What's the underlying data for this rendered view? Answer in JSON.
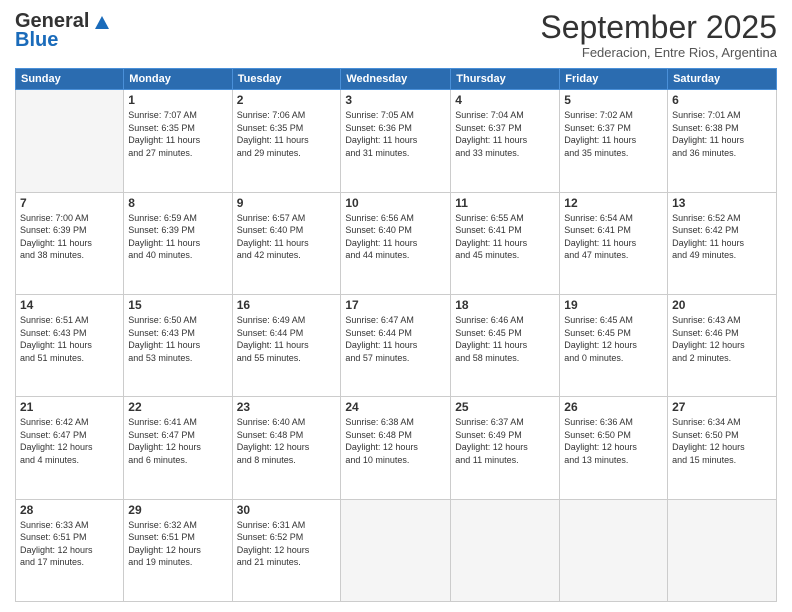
{
  "header": {
    "logo_general": "General",
    "logo_blue": "Blue",
    "month": "September 2025",
    "location": "Federacion, Entre Rios, Argentina"
  },
  "weekdays": [
    "Sunday",
    "Monday",
    "Tuesday",
    "Wednesday",
    "Thursday",
    "Friday",
    "Saturday"
  ],
  "weeks": [
    [
      {
        "day": "",
        "info": ""
      },
      {
        "day": "1",
        "info": "Sunrise: 7:07 AM\nSunset: 6:35 PM\nDaylight: 11 hours\nand 27 minutes."
      },
      {
        "day": "2",
        "info": "Sunrise: 7:06 AM\nSunset: 6:35 PM\nDaylight: 11 hours\nand 29 minutes."
      },
      {
        "day": "3",
        "info": "Sunrise: 7:05 AM\nSunset: 6:36 PM\nDaylight: 11 hours\nand 31 minutes."
      },
      {
        "day": "4",
        "info": "Sunrise: 7:04 AM\nSunset: 6:37 PM\nDaylight: 11 hours\nand 33 minutes."
      },
      {
        "day": "5",
        "info": "Sunrise: 7:02 AM\nSunset: 6:37 PM\nDaylight: 11 hours\nand 35 minutes."
      },
      {
        "day": "6",
        "info": "Sunrise: 7:01 AM\nSunset: 6:38 PM\nDaylight: 11 hours\nand 36 minutes."
      }
    ],
    [
      {
        "day": "7",
        "info": "Sunrise: 7:00 AM\nSunset: 6:39 PM\nDaylight: 11 hours\nand 38 minutes."
      },
      {
        "day": "8",
        "info": "Sunrise: 6:59 AM\nSunset: 6:39 PM\nDaylight: 11 hours\nand 40 minutes."
      },
      {
        "day": "9",
        "info": "Sunrise: 6:57 AM\nSunset: 6:40 PM\nDaylight: 11 hours\nand 42 minutes."
      },
      {
        "day": "10",
        "info": "Sunrise: 6:56 AM\nSunset: 6:40 PM\nDaylight: 11 hours\nand 44 minutes."
      },
      {
        "day": "11",
        "info": "Sunrise: 6:55 AM\nSunset: 6:41 PM\nDaylight: 11 hours\nand 45 minutes."
      },
      {
        "day": "12",
        "info": "Sunrise: 6:54 AM\nSunset: 6:41 PM\nDaylight: 11 hours\nand 47 minutes."
      },
      {
        "day": "13",
        "info": "Sunrise: 6:52 AM\nSunset: 6:42 PM\nDaylight: 11 hours\nand 49 minutes."
      }
    ],
    [
      {
        "day": "14",
        "info": "Sunrise: 6:51 AM\nSunset: 6:43 PM\nDaylight: 11 hours\nand 51 minutes."
      },
      {
        "day": "15",
        "info": "Sunrise: 6:50 AM\nSunset: 6:43 PM\nDaylight: 11 hours\nand 53 minutes."
      },
      {
        "day": "16",
        "info": "Sunrise: 6:49 AM\nSunset: 6:44 PM\nDaylight: 11 hours\nand 55 minutes."
      },
      {
        "day": "17",
        "info": "Sunrise: 6:47 AM\nSunset: 6:44 PM\nDaylight: 11 hours\nand 57 minutes."
      },
      {
        "day": "18",
        "info": "Sunrise: 6:46 AM\nSunset: 6:45 PM\nDaylight: 11 hours\nand 58 minutes."
      },
      {
        "day": "19",
        "info": "Sunrise: 6:45 AM\nSunset: 6:45 PM\nDaylight: 12 hours\nand 0 minutes."
      },
      {
        "day": "20",
        "info": "Sunrise: 6:43 AM\nSunset: 6:46 PM\nDaylight: 12 hours\nand 2 minutes."
      }
    ],
    [
      {
        "day": "21",
        "info": "Sunrise: 6:42 AM\nSunset: 6:47 PM\nDaylight: 12 hours\nand 4 minutes."
      },
      {
        "day": "22",
        "info": "Sunrise: 6:41 AM\nSunset: 6:47 PM\nDaylight: 12 hours\nand 6 minutes."
      },
      {
        "day": "23",
        "info": "Sunrise: 6:40 AM\nSunset: 6:48 PM\nDaylight: 12 hours\nand 8 minutes."
      },
      {
        "day": "24",
        "info": "Sunrise: 6:38 AM\nSunset: 6:48 PM\nDaylight: 12 hours\nand 10 minutes."
      },
      {
        "day": "25",
        "info": "Sunrise: 6:37 AM\nSunset: 6:49 PM\nDaylight: 12 hours\nand 11 minutes."
      },
      {
        "day": "26",
        "info": "Sunrise: 6:36 AM\nSunset: 6:50 PM\nDaylight: 12 hours\nand 13 minutes."
      },
      {
        "day": "27",
        "info": "Sunrise: 6:34 AM\nSunset: 6:50 PM\nDaylight: 12 hours\nand 15 minutes."
      }
    ],
    [
      {
        "day": "28",
        "info": "Sunrise: 6:33 AM\nSunset: 6:51 PM\nDaylight: 12 hours\nand 17 minutes."
      },
      {
        "day": "29",
        "info": "Sunrise: 6:32 AM\nSunset: 6:51 PM\nDaylight: 12 hours\nand 19 minutes."
      },
      {
        "day": "30",
        "info": "Sunrise: 6:31 AM\nSunset: 6:52 PM\nDaylight: 12 hours\nand 21 minutes."
      },
      {
        "day": "",
        "info": ""
      },
      {
        "day": "",
        "info": ""
      },
      {
        "day": "",
        "info": ""
      },
      {
        "day": "",
        "info": ""
      }
    ]
  ]
}
